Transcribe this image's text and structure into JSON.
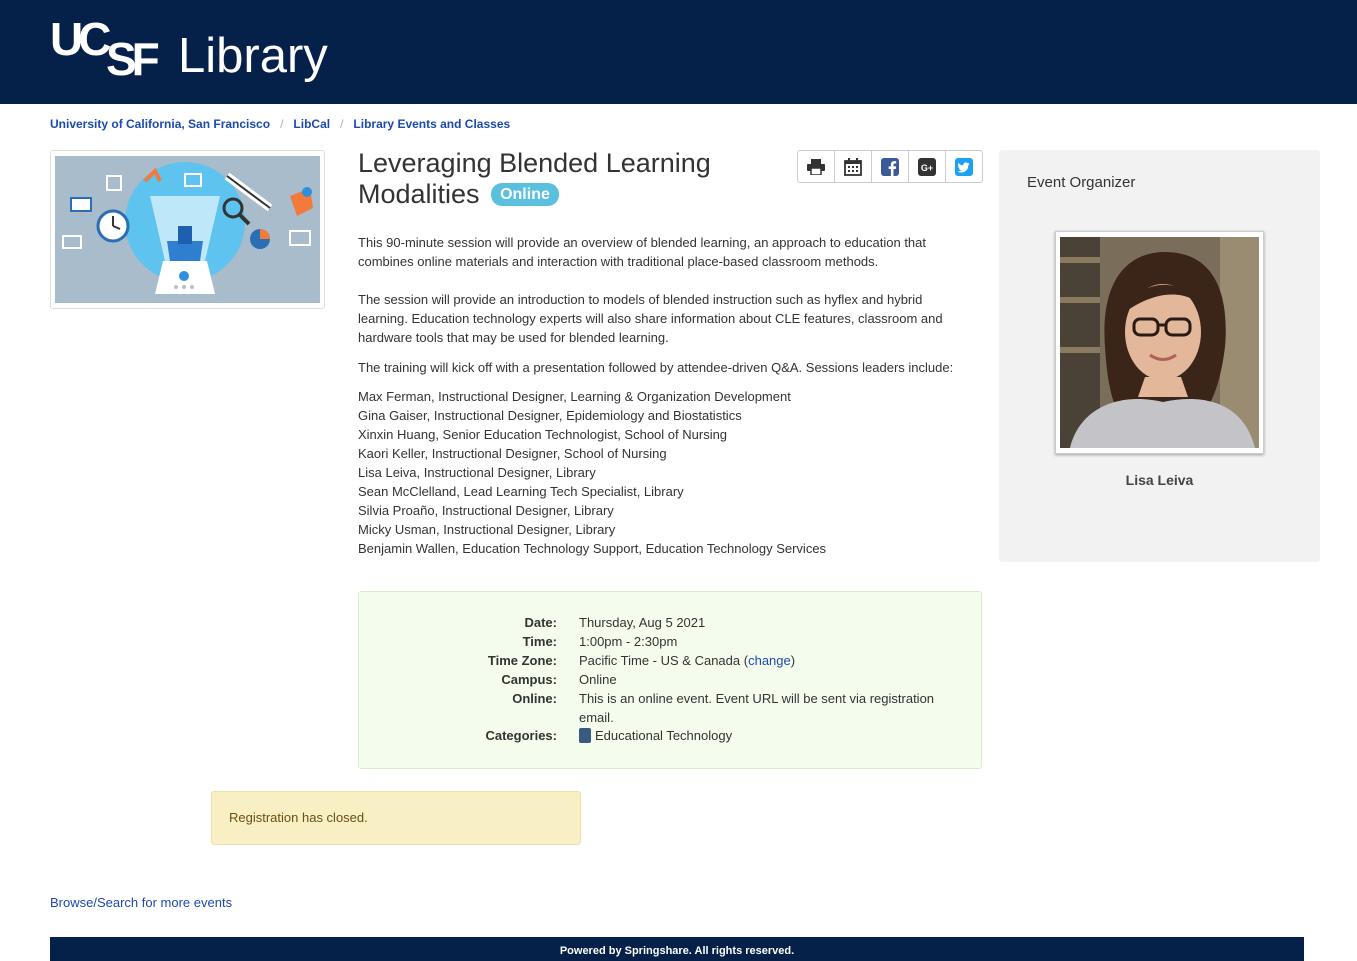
{
  "header": {
    "logo_top": "UC",
    "logo_bottom": "SF",
    "logo_product": "Library"
  },
  "breadcrumb": {
    "items": [
      "University of California, San Francisco",
      "LibCal",
      "Library Events and Classes"
    ],
    "separator": "/"
  },
  "event": {
    "title": "Leveraging Blended Learning Modalities",
    "badge": "Online",
    "paragraphs": [
      "This 90-minute session will provide an overview of blended learning, an approach to education that combines online materials and interaction with traditional place-based classroom methods.",
      "The session will provide an introduction to models of blended instruction such as hyflex and hybrid learning. Education technology experts will also share information about CLE features, classroom and hardware tools that may be used for blended learning.",
      "The training will kick off with a presentation followed by attendee-driven Q&A. Sessions leaders include:"
    ],
    "leaders": [
      "Max Ferman, Instructional Designer, Learning & Organization Development",
      "Gina Gaiser, Instructional Designer, Epidemiology and Biostatistics",
      "Xinxin Huang, Senior Education Technologist, School of Nursing",
      "Kaori Keller, Instructional Designer, School of Nursing",
      "Lisa Leiva, Instructional Designer, Library",
      "Sean McClelland, Lead Learning Tech Specialist, Library",
      "Silvia Proaño, Instructional Designer, Library",
      "Micky Usman, Instructional Designer, Library",
      "Benjamin Wallen, Education Technology Support, Education Technology Services"
    ]
  },
  "share": {
    "icons": [
      "print-icon",
      "calendar-icon",
      "facebook-icon",
      "google-plus-icon",
      "twitter-icon"
    ],
    "gplus_text": "G+"
  },
  "details": {
    "date_label": "Date:",
    "date": "Thursday, Aug 5 2021",
    "time_label": "Time:",
    "time": "1:00pm - 2:30pm",
    "tz_label": "Time Zone:",
    "tz": "Pacific Time - US & Canada",
    "tz_open": "(",
    "tz_change": "change",
    "tz_close": ")",
    "campus_label": "Campus:",
    "campus": "Online",
    "online_label": "Online:",
    "online": "This is an online event. Event URL will be sent via registration email.",
    "categories_label": "Categories:",
    "category": "Educational Technology",
    "category_color": "#3a5a80"
  },
  "registration": {
    "message": "Registration has closed."
  },
  "browse_link": "Browse/Search for more events",
  "organizer": {
    "heading": "Event Organizer",
    "name": "Lisa Leiva"
  },
  "footer": {
    "text": "Powered by Springshare. All rights reserved."
  },
  "colors": {
    "header_bg": "#052049",
    "link": "#1b49b0",
    "badge": "#5bc0de",
    "details_bg": "#f4fded",
    "alert_bg": "#f8efc5"
  }
}
